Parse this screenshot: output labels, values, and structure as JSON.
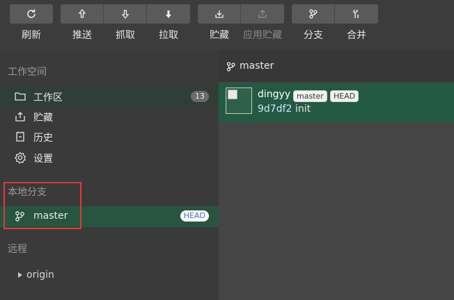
{
  "toolbar": {
    "refresh": "刷新",
    "push": "推送",
    "fetch": "抓取",
    "pull": "拉取",
    "stash": "贮藏",
    "apply_stash": "应用贮藏",
    "branch": "分支",
    "merge": "合并"
  },
  "sidebar": {
    "workspace_title": "工作空间",
    "items": [
      {
        "label": "工作区",
        "icon": "folder-icon",
        "count": "13"
      },
      {
        "label": "贮藏",
        "icon": "stash-icon"
      },
      {
        "label": "历史",
        "icon": "history-icon"
      },
      {
        "label": "设置",
        "icon": "gear-icon"
      }
    ],
    "local_branches_title": "本地分支",
    "branch": {
      "name": "master",
      "badge": "HEAD"
    },
    "remote_title": "远程",
    "remote": {
      "name": "origin"
    }
  },
  "main": {
    "current_branch": "master",
    "commit": {
      "author": "dingyy",
      "refs": [
        "master",
        "HEAD"
      ],
      "hash": "9d7df2",
      "message": "init"
    }
  },
  "colors": {
    "selected_row": "#235a44",
    "highlight_box": "#e03a3a"
  }
}
